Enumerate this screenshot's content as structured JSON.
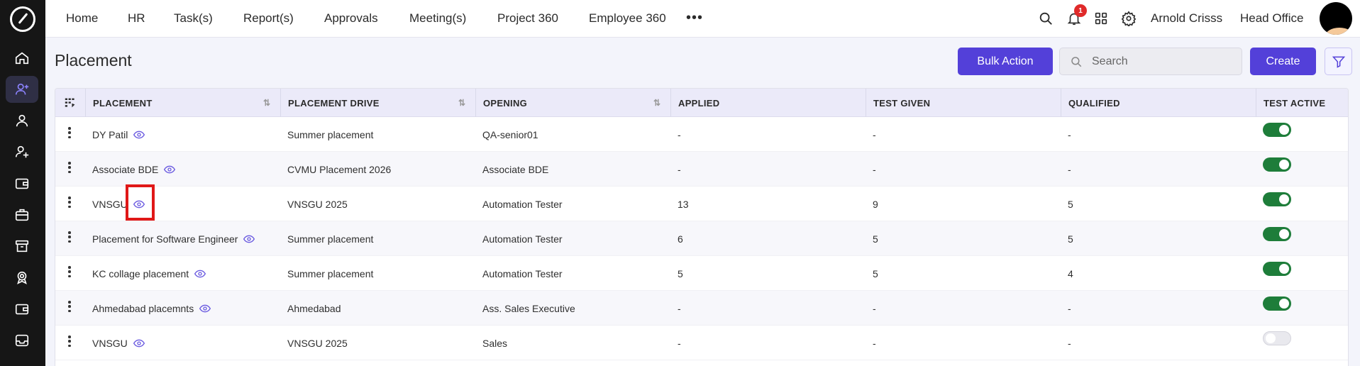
{
  "nav": {
    "items": [
      "Home",
      "HR",
      "Task(s)",
      "Report(s)",
      "Approvals",
      "Meeting(s)",
      "Project 360",
      "Employee 360"
    ],
    "more_label": "•••",
    "notification_count": "1",
    "user_name": "Arnold Crisss",
    "office": "Head Office"
  },
  "sidebar": {
    "icons": [
      "home-icon",
      "user-plus-icon",
      "user-icon",
      "user-add-icon",
      "wallet-icon",
      "briefcase-icon",
      "archive-icon",
      "award-icon",
      "wallet-alt-icon",
      "inbox-icon"
    ],
    "active_index": 1
  },
  "page": {
    "title": "Placement",
    "bulk_action_label": "Bulk Action",
    "search_placeholder": "Search",
    "create_label": "Create"
  },
  "table": {
    "columns": [
      "PLACEMENT",
      "PLACEMENT DRIVE",
      "OPENING",
      "APPLIED",
      "TEST GIVEN",
      "QUALIFIED",
      "TEST ACTIVE"
    ],
    "rows": [
      {
        "placement": "DY Patil",
        "drive": "Summer placement",
        "opening": "QA-senior01",
        "applied": "-",
        "test_given": "-",
        "qualified": "-",
        "test_active": true
      },
      {
        "placement": "Associate BDE",
        "drive": "CVMU Placement 2026",
        "opening": "Associate BDE",
        "applied": "-",
        "test_given": "-",
        "qualified": "-",
        "test_active": true
      },
      {
        "placement": "VNSGU",
        "drive": "VNSGU 2025",
        "opening": "Automation Tester",
        "applied": "13",
        "test_given": "9",
        "qualified": "5",
        "test_active": true
      },
      {
        "placement": "Placement for Software Engineer",
        "drive": "Summer placement",
        "opening": "Automation Tester",
        "applied": "6",
        "test_given": "5",
        "qualified": "5",
        "test_active": true
      },
      {
        "placement": "KC collage placement",
        "drive": "Summer placement",
        "opening": "Automation Tester",
        "applied": "5",
        "test_given": "5",
        "qualified": "4",
        "test_active": true
      },
      {
        "placement": "Ahmedabad placemnts",
        "drive": "Ahmedabad",
        "opening": "Ass. Sales Executive",
        "applied": "-",
        "test_given": "-",
        "qualified": "-",
        "test_active": true
      },
      {
        "placement": "VNSGU",
        "drive": "VNSGU 2025",
        "opening": "Sales",
        "applied": "-",
        "test_given": "-",
        "qualified": "-",
        "test_active": false
      }
    ]
  },
  "colors": {
    "accent": "#5340d9",
    "sidebar_bg": "#161616",
    "toggle_on": "#1e7d3a",
    "highlight": "#e01818"
  }
}
